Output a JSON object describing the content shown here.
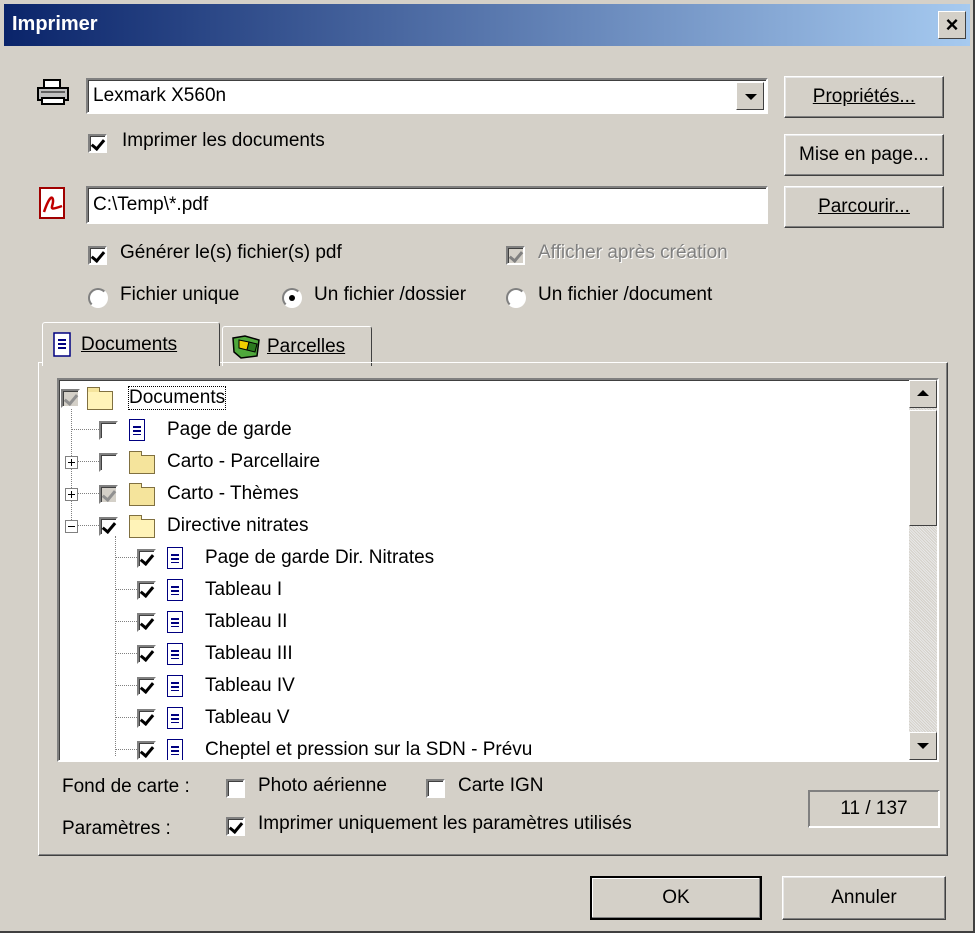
{
  "window": {
    "title": "Imprimer",
    "close_glyph": "×"
  },
  "printer": {
    "icon": "printer-icon",
    "selected": "Lexmark X560n",
    "print_docs_label": "Imprimer les documents",
    "print_docs_checked": true
  },
  "pdf": {
    "icon": "pdf-icon",
    "path": "C:\\Temp\\*.pdf",
    "generate_label": "Générer le(s) fichier(s) pdf",
    "generate_checked": true,
    "show_after_label": "Afficher après création",
    "show_after_checked": true,
    "show_after_disabled": true,
    "mode_options": [
      "Fichier unique",
      "Un fichier /dossier",
      "Un fichier /document"
    ],
    "mode_selected": "Un fichier /dossier"
  },
  "buttons": {
    "properties": "Propriétés...",
    "page_setup": "Mise en page...",
    "browse": "Parcourir...",
    "ok": "OK",
    "cancel": "Annuler"
  },
  "tabs": [
    {
      "label": "Documents",
      "icon": "document-icon",
      "active": true
    },
    {
      "label": "Parcelles",
      "icon": "parcels-map-icon",
      "active": false
    }
  ],
  "tree": {
    "items": [
      {
        "label": "Documents",
        "type": "folder-open",
        "state": "indeterminate",
        "level": 0,
        "selected": true
      },
      {
        "label": "Page de garde",
        "type": "doc",
        "state": "unchecked",
        "level": 1
      },
      {
        "label": "Carto - Parcellaire",
        "type": "folder",
        "state": "unchecked",
        "level": 1,
        "expander": "plus"
      },
      {
        "label": "Carto - Thèmes",
        "type": "folder",
        "state": "indeterminate",
        "level": 1,
        "expander": "plus"
      },
      {
        "label": "Directive nitrates",
        "type": "folder-open",
        "state": "checked",
        "level": 1,
        "expander": "minus"
      },
      {
        "label": "Page de garde Dir. Nitrates",
        "type": "doc",
        "state": "checked",
        "level": 2
      },
      {
        "label": "Tableau I",
        "type": "doc",
        "state": "checked",
        "level": 2
      },
      {
        "label": "Tableau II",
        "type": "doc",
        "state": "checked",
        "level": 2
      },
      {
        "label": "Tableau III",
        "type": "doc",
        "state": "checked",
        "level": 2
      },
      {
        "label": "Tableau IV",
        "type": "doc",
        "state": "checked",
        "level": 2
      },
      {
        "label": "Tableau V",
        "type": "doc",
        "state": "checked",
        "level": 2
      },
      {
        "label": "Cheptel et pression sur la SDN - Prévu",
        "type": "doc",
        "state": "checked",
        "level": 2
      }
    ]
  },
  "basemap": {
    "label": "Fond de carte :",
    "photo_label": "Photo aérienne",
    "photo_checked": false,
    "ign_label": "Carte IGN",
    "ign_checked": false
  },
  "params": {
    "label": "Paramètres :",
    "only_used_label": "Imprimer uniquement les paramètres utilisés",
    "only_used_checked": true
  },
  "counter": "11 / 137"
}
